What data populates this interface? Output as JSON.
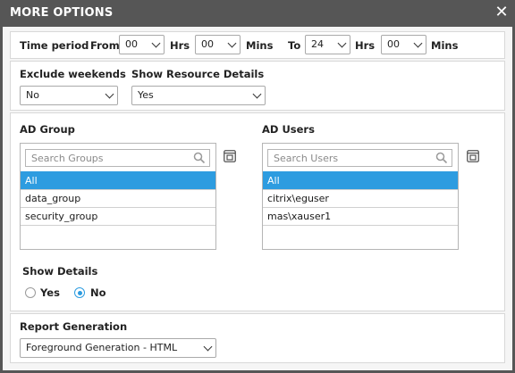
{
  "dialog": {
    "title": "MORE OPTIONS",
    "close_glyph": "✕"
  },
  "time_period": {
    "label": "Time period",
    "from_label": "From",
    "from_hrs": "00",
    "hrs_label": "Hrs",
    "from_mins": "00",
    "mins_label": "Mins",
    "to_label": "To",
    "to_hrs": "24",
    "to_mins": "00"
  },
  "exclude_weekends": {
    "label": "Exclude weekends",
    "value": "No"
  },
  "resource_details": {
    "label": "Show Resource Details",
    "value": "Yes"
  },
  "ad_group": {
    "label": "AD Group",
    "search_placeholder": "Search Groups",
    "items": [
      "All",
      "data_group",
      "security_group"
    ],
    "selected": "All"
  },
  "ad_users": {
    "label": "AD Users",
    "search_placeholder": "Search Users",
    "items": [
      "All",
      "citrix\\eguser",
      "mas\\xauser1"
    ],
    "selected": "All"
  },
  "show_details": {
    "label": "Show Details",
    "options": [
      "Yes",
      "No"
    ],
    "selected": "No"
  },
  "report_generation": {
    "label": "Report Generation",
    "value": "Foreground Generation - HTML"
  },
  "colors": {
    "titlebar": "#565656",
    "accent": "#2d9ce0",
    "panel": "#f5f5f5"
  },
  "icons": {
    "close": "close-icon",
    "search": "search-icon",
    "expand": "expand-icon",
    "dropdown": "chevron-down-icon"
  }
}
